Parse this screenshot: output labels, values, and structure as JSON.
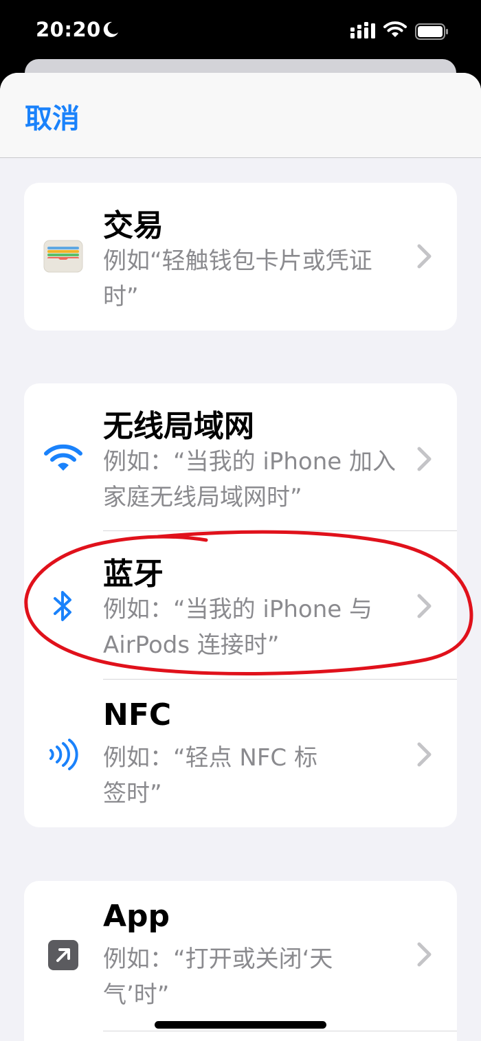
{
  "status_bar": {
    "time": "20:20"
  },
  "nav": {
    "cancel_label": "取消"
  },
  "groups": [
    {
      "rows": [
        {
          "title": "交易",
          "subtitle": "例如“轻触钱包卡片或凭证时”",
          "icon": "wallet-icon"
        }
      ]
    },
    {
      "rows": [
        {
          "title": "无线局域网",
          "subtitle": "例如：“当我的 iPhone 加入家庭无线局域网时”",
          "icon": "wifi-icon"
        },
        {
          "title": "蓝牙",
          "subtitle": "例如：“当我的 iPhone 与 AirPods 连接时”",
          "icon": "bluetooth-icon"
        },
        {
          "title": "NFC",
          "subtitle": "例如：“轻点 NFC 标签时”",
          "icon": "nfc-icon"
        }
      ]
    },
    {
      "rows": [
        {
          "title": "App",
          "subtitle": "例如：“打开或关闭‘天气’时”",
          "icon": "app-arrow-icon"
        }
      ]
    }
  ],
  "colors": {
    "accent": "#1a82fb",
    "background": "#f2f2f7",
    "annotation": "#e0111b",
    "secondary_text": "#8a8a8e"
  }
}
